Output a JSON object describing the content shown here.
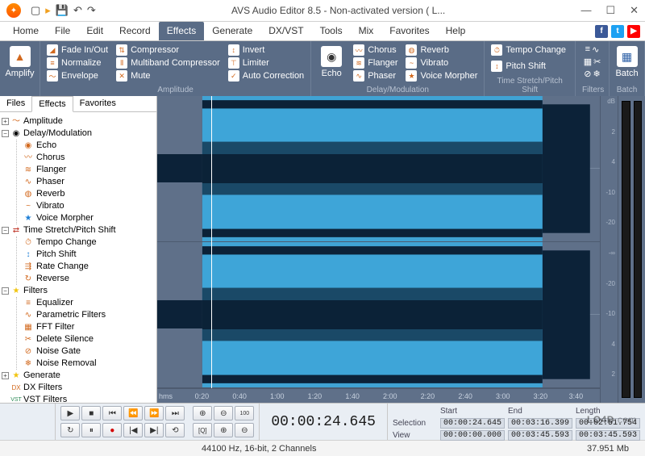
{
  "title": "AVS Audio Editor 8.5 - Non-activated version ( L...",
  "menu": [
    "Home",
    "File",
    "Edit",
    "Record",
    "Effects",
    "Generate",
    "DX/VST",
    "Tools",
    "Mix",
    "Favorites",
    "Help"
  ],
  "menu_active": "Effects",
  "ribbon": {
    "amplify": "Amplify",
    "amplitude_group": "Amplitude",
    "amp_items": [
      "Fade In/Out",
      "Normalize",
      "Envelope",
      "Compressor",
      "Multiband Compressor",
      "Mute",
      "Invert",
      "Limiter",
      "Auto Correction"
    ],
    "echo": "Echo",
    "delay_group": "Delay/Modulation",
    "delay_items": [
      "Chorus",
      "Flanger",
      "Phaser",
      "Reverb",
      "Vibrato",
      "Voice Morpher"
    ],
    "time_group": "Time Stretch/Pitch Shift",
    "time_items": [
      "Tempo Change",
      "Pitch Shift"
    ],
    "filters_group": "Filters",
    "batch_group": "Batch",
    "batch": "Batch"
  },
  "left_tabs": [
    "Files",
    "Effects",
    "Favorites"
  ],
  "left_active": "Effects",
  "tree": {
    "amplitude": "Amplitude",
    "delay": "Delay/Modulation",
    "delay_children": [
      "Echo",
      "Chorus",
      "Flanger",
      "Phaser",
      "Reverb",
      "Vibrato",
      "Voice Morpher"
    ],
    "time": "Time Stretch/Pitch Shift",
    "time_children": [
      "Tempo Change",
      "Pitch Shift",
      "Rate Change",
      "Reverse"
    ],
    "filters": "Filters",
    "filters_children": [
      "Equalizer",
      "Parametric Filters",
      "FFT Filter",
      "Delete Silence",
      "Noise Gate",
      "Noise Removal"
    ],
    "generate": "Generate",
    "dx": "DX Filters",
    "vst": "VST Filters"
  },
  "db_ticks": [
    "dB",
    "2",
    "4",
    "-10",
    "-20",
    "-∞",
    "-20",
    "-10",
    "4",
    "2"
  ],
  "ruler_ticks": [
    "hms",
    "0:20",
    "0:40",
    "1:00",
    "1:20",
    "1:40",
    "2:00",
    "2:20",
    "2:40",
    "3:00",
    "3:20",
    "3:40"
  ],
  "timecode": "00:00:24.645",
  "selgrid": {
    "headers": [
      "Start",
      "End",
      "Length"
    ],
    "rows": [
      {
        "label": "Selection",
        "start": "00:00:24.645",
        "end": "00:03:16.399",
        "length": "00:02:51.754"
      },
      {
        "label": "View",
        "start": "00:00:00.000",
        "end": "00:03:45.593",
        "length": "00:03:45.593"
      }
    ]
  },
  "status": {
    "format": "44100 Hz, 16-bit, 2 Channels",
    "size": "37.951 Mb"
  },
  "watermark": "LO4D.com"
}
